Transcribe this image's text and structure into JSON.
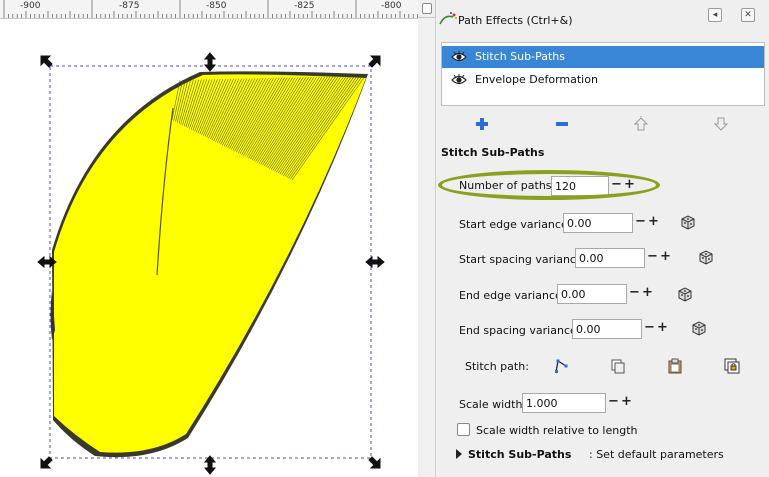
{
  "ruler": {
    "labels": [
      "-900",
      "-875",
      "-850",
      "-825",
      "-800"
    ]
  },
  "dialog": {
    "title": "Path Effects (Ctrl+&)",
    "effects": [
      {
        "label": "Stitch Sub-Paths",
        "selected": true
      },
      {
        "label": "Envelope Deformation",
        "selected": false
      }
    ],
    "toolbar": {
      "add_icon": "plus-icon",
      "remove_icon": "minus-icon",
      "up_icon": "arrow-up-icon",
      "down_icon": "arrow-down-icon"
    },
    "section_title": "Stitch Sub-Paths",
    "params": {
      "number_of_paths": {
        "label": "Number of paths:",
        "value": "120"
      },
      "start_edge_variance": {
        "label": "Start edge variance:",
        "value": "0.00"
      },
      "start_spacing_variance": {
        "label": "Start spacing variance:",
        "value": "0.00"
      },
      "end_edge_variance": {
        "label": "End edge variance:",
        "value": "0.00"
      },
      "end_spacing_variance": {
        "label": "End spacing variance:",
        "value": "0.00"
      },
      "stitch_path": {
        "label": "Stitch path:"
      },
      "scale_width": {
        "label": "Scale width:",
        "value": "1.000"
      },
      "scale_relative": {
        "label": "Scale width relative to length",
        "checked": false
      }
    },
    "footer": {
      "bold": "Stitch Sub-Paths",
      "rest": ": Set default parameters"
    },
    "spin_minus": "−",
    "spin_plus": "+"
  },
  "colors": {
    "shape_fill": "#ffff00",
    "selection": "#3a86d6",
    "highlight_ellipse": "#8aa120"
  }
}
